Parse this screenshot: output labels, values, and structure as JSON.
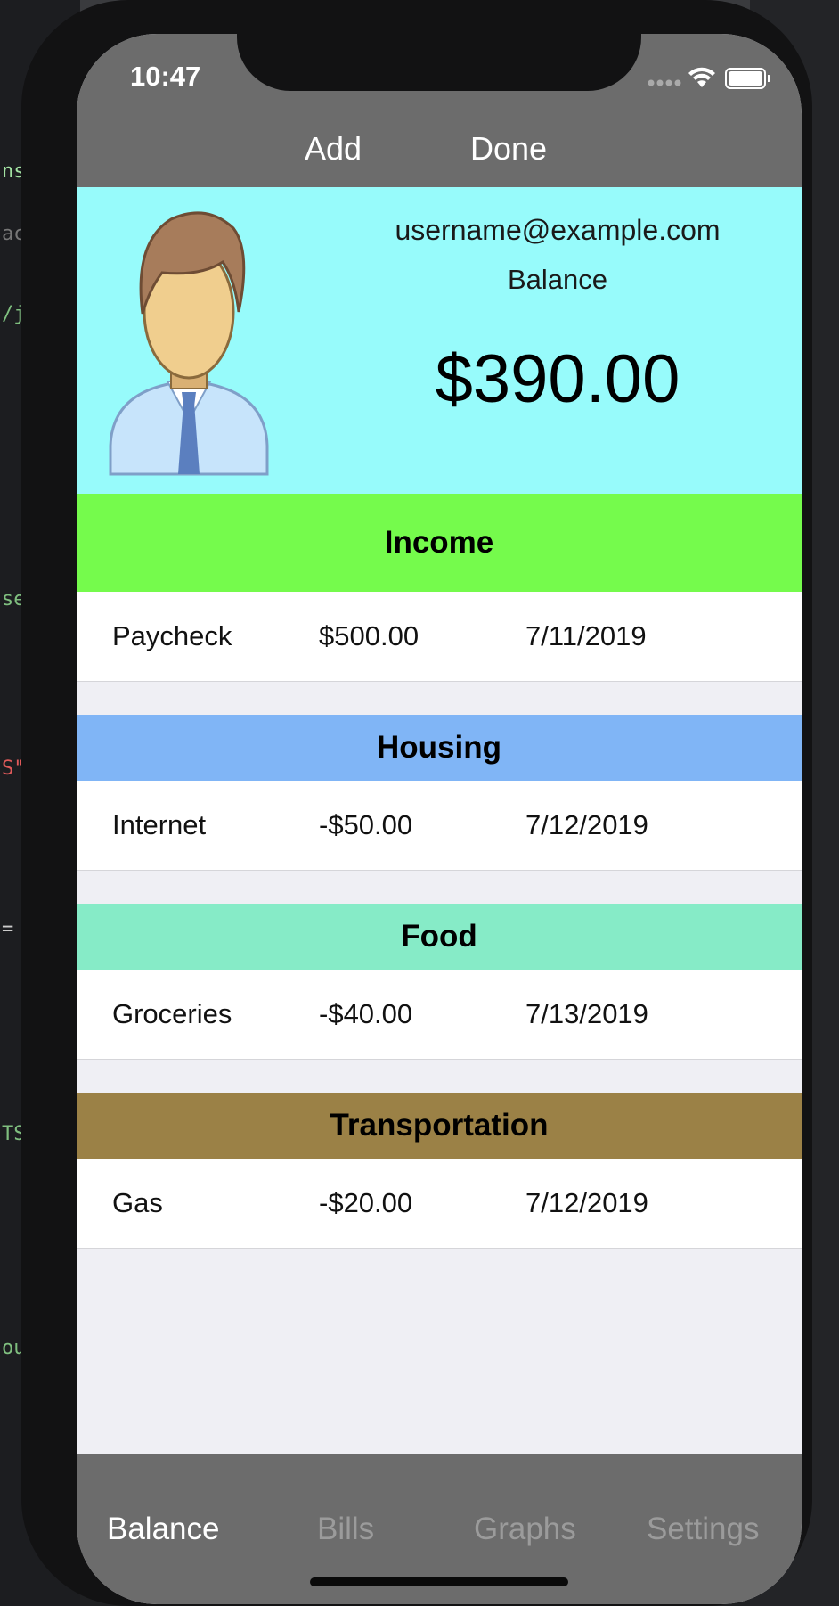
{
  "status": {
    "time": "10:47"
  },
  "nav": {
    "add_label": "Add",
    "done_label": "Done"
  },
  "profile": {
    "email": "username@example.com",
    "balance_label": "Balance",
    "balance_amount": "$390.00"
  },
  "sections": [
    {
      "title": "Income",
      "color": "#75fb4c",
      "rows": [
        {
          "name": "Paycheck",
          "amount": "$500.00",
          "date": "7/11/2019"
        }
      ]
    },
    {
      "title": "Housing",
      "color": "#80b5f6",
      "rows": [
        {
          "name": "Internet",
          "amount": "-$50.00",
          "date": "7/12/2019"
        }
      ]
    },
    {
      "title": "Food",
      "color": "#86ebc7",
      "rows": [
        {
          "name": "Groceries",
          "amount": "-$40.00",
          "date": "7/13/2019"
        }
      ]
    },
    {
      "title": "Transportation",
      "color": "#9b8146",
      "rows": [
        {
          "name": "Gas",
          "amount": "-$20.00",
          "date": "7/12/2019"
        }
      ]
    }
  ],
  "tabs": [
    {
      "label": "Balance",
      "active": true
    },
    {
      "label": "Bills",
      "active": false
    },
    {
      "label": "Graphs",
      "active": false
    },
    {
      "label": "Settings",
      "active": false
    }
  ],
  "icons": {
    "avatar": "user-avatar-icon",
    "signal": "cellular-signal-icon",
    "wifi": "wifi-icon",
    "battery": "battery-icon"
  },
  "colors": {
    "navbar": "#6c6c6c",
    "profile_bg": "#97fbfb",
    "tab_active": "#ffffff",
    "tab_inactive": "#9b9b9b"
  }
}
